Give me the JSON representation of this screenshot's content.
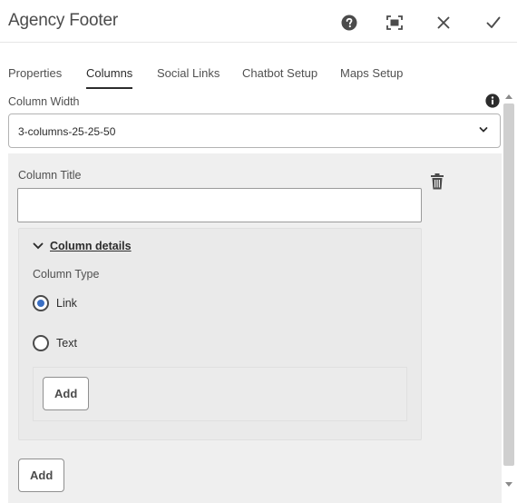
{
  "dialog": {
    "title": "Agency Footer",
    "icons": {
      "help": "help-icon",
      "fullscreen": "fullscreen-icon",
      "close": "close-icon",
      "done": "checkmark-icon"
    }
  },
  "tabs": [
    {
      "label": "Properties",
      "active": false
    },
    {
      "label": "Columns",
      "active": true
    },
    {
      "label": "Social Links",
      "active": false
    },
    {
      "label": "Chatbot Setup",
      "active": false
    },
    {
      "label": "Maps Setup",
      "active": false
    }
  ],
  "column_width": {
    "label": "Column Width",
    "value": "3-columns-25-25-50",
    "info_icon": "info-icon"
  },
  "column_item": {
    "title_label": "Column Title",
    "title_value": "",
    "delete_icon": "trash-icon",
    "details": {
      "toggle_label": "Column details",
      "expanded": true,
      "column_type_label": "Column Type",
      "options": [
        {
          "label": "Link",
          "checked": true
        },
        {
          "label": "Text",
          "checked": false
        }
      ],
      "add_label": "Add"
    }
  },
  "add_column_label": "Add",
  "colors": {
    "accent": "#3a6fc4",
    "panel": "#efefef",
    "text": "#2c2c2c"
  }
}
